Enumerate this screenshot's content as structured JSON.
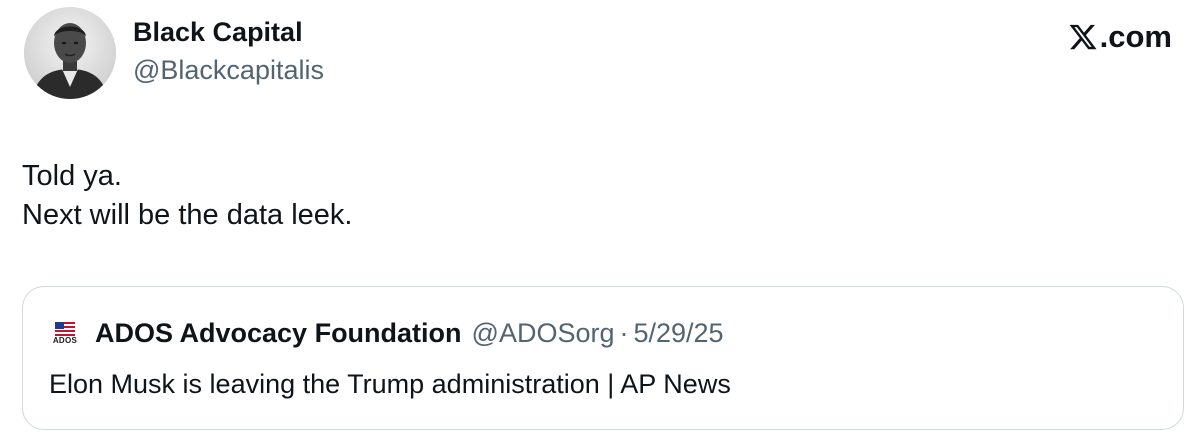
{
  "author": {
    "display_name": "Black Capital",
    "handle": "@Blackcapitalis",
    "avatar": "portrait-photo-avatar"
  },
  "site_mark": {
    "icon": "x-logo-icon",
    "suffix": ".com"
  },
  "tweet": {
    "lines": [
      "Told ya.",
      "Next will be the data leek."
    ]
  },
  "quoted_tweet": {
    "avatar_text": "ADOS",
    "display_name": "ADOS Advocacy Foundation",
    "handle": "@ADOSorg",
    "separator": "·",
    "date": "5/29/25",
    "text": "Elon Musk is leaving the Trump administration | AP News"
  },
  "colors": {
    "text_primary": "#0f1419",
    "text_secondary": "#536471",
    "border": "#cfd9de",
    "background": "#ffffff"
  }
}
